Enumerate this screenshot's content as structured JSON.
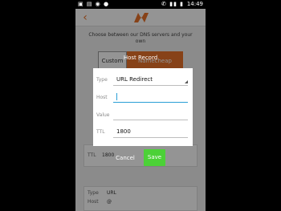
{
  "status_bar": {
    "left_icons": "▣ ▤ ◉ ●",
    "right_icons": "✆ ▮▮ ▮",
    "time": "14:49"
  },
  "app_bar": {
    "back_icon": "‹"
  },
  "background": {
    "instruction": "Choose between our DNS servers and your own",
    "segment_custom": "Custom",
    "segment_namecheap": "Namecheap",
    "card_label": "TTL",
    "card_value": "1800",
    "rows": [
      {
        "label": "Type",
        "value": "URL"
      },
      {
        "label": "Host",
        "value": "@"
      }
    ]
  },
  "dialog": {
    "title": "Host Record",
    "type_label": "Type",
    "type_value": "URL Redirect",
    "host_label": "Host",
    "host_value": "",
    "value_label": "Value",
    "value_value": "",
    "ttl_label": "TTL",
    "ttl_value": "1800"
  },
  "buttons": {
    "cancel": "Cancel",
    "save": "Save"
  },
  "colors": {
    "accent": "#e8732a",
    "save": "#4cd137",
    "focus": "#2a9fd6"
  }
}
